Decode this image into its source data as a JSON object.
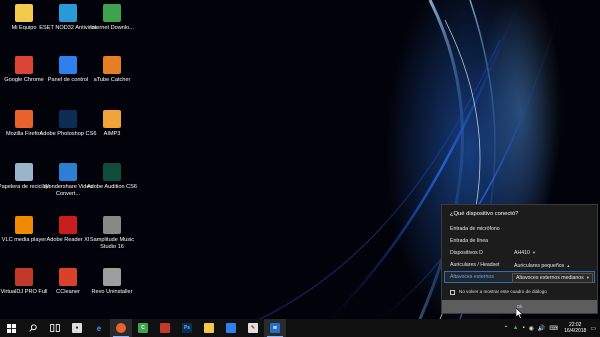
{
  "desktop": {
    "icons": [
      {
        "label": "Mi Equipo",
        "glyph": "folder-icon",
        "color": "#f2c94c"
      },
      {
        "label": "ESET NOD32 Antivirus",
        "glyph": "eset-icon",
        "color": "#2a9ad6"
      },
      {
        "label": "Internet Downlo...",
        "glyph": "idm-icon",
        "color": "#3fa34d"
      },
      {
        "label": "Google Chrome",
        "glyph": "chrome-icon",
        "color": "#db4437"
      },
      {
        "label": "Panel de control",
        "glyph": "control-panel-icon",
        "color": "#2f80ed"
      },
      {
        "label": "aTube Catcher",
        "glyph": "atube-icon",
        "color": "#e67e22"
      },
      {
        "label": "Mozilla Firefox",
        "glyph": "firefox-icon",
        "color": "#e8632b"
      },
      {
        "label": "Adobe Photoshop CS6",
        "glyph": "photoshop-icon",
        "color": "#0b2d54"
      },
      {
        "label": "AIMP3",
        "glyph": "aimp-icon",
        "color": "#f2a33a"
      },
      {
        "label": "Papelera de reciclaje",
        "glyph": "recycle-bin-icon",
        "color": "#9ab4c8"
      },
      {
        "label": "Wondershare Video Convert...",
        "glyph": "wondershare-icon",
        "color": "#2d7fd3"
      },
      {
        "label": "Adobe Audition CS6",
        "glyph": "audition-icon",
        "color": "#0f4d3a"
      },
      {
        "label": "VLC media player",
        "glyph": "vlc-icon",
        "color": "#f08a00"
      },
      {
        "label": "Adobe Reader XI",
        "glyph": "adobe-reader-icon",
        "color": "#c81e1e"
      },
      {
        "label": "Samplitude Music Studio 16",
        "glyph": "samplitude-icon",
        "color": "#888888"
      },
      {
        "label": "VirtualDJ PRO Full",
        "glyph": "virtualdj-icon",
        "color": "#c0392b"
      },
      {
        "label": "CCleaner",
        "glyph": "ccleaner-icon",
        "color": "#d9412b"
      },
      {
        "label": "Revo Uninstaller",
        "glyph": "revo-icon",
        "color": "#9e9e9e"
      }
    ]
  },
  "dialog": {
    "title": "¿Qué dispositivo conectó?",
    "options": [
      {
        "label": "Entrada de micrófono"
      },
      {
        "label": "Entrada de línea"
      },
      {
        "label": "Dispositivos D",
        "value": "AH410"
      },
      {
        "label": "Auriculares / Headset",
        "value": "Auriculares pequeños"
      },
      {
        "label": "Altavoces externos",
        "value": "Altavoces externos medianos"
      }
    ],
    "checkbox_label": "No volver a mostrar este cuadro de diálogo",
    "ok_label": "Ok"
  },
  "taskbar": {
    "time": "22:02",
    "date": "16/4/2018"
  }
}
